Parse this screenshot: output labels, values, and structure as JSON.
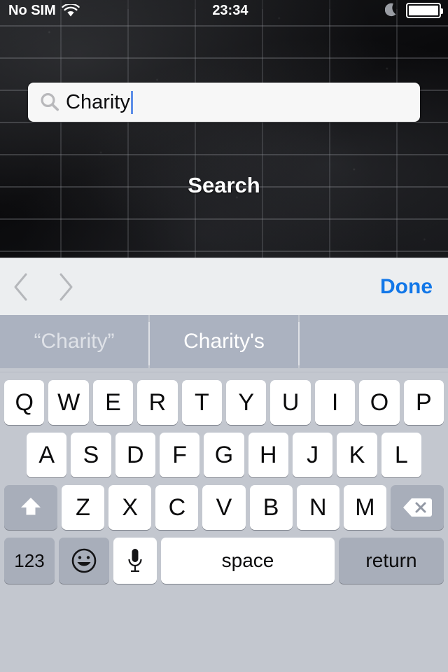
{
  "status_bar": {
    "carrier": "No SIM",
    "wifi_icon": "wifi-icon",
    "time": "23:34",
    "dnd_icon": "moon-icon",
    "battery_icon": "battery-full-icon"
  },
  "app": {
    "background": "brick-wall-photo",
    "search": {
      "icon": "search-icon",
      "value": "Charity",
      "placeholder": "Search",
      "caret_color": "#5e8fe8"
    },
    "search_button_label": "Search"
  },
  "accessory_bar": {
    "prev_icon": "chevron-left-icon",
    "next_icon": "chevron-right-icon",
    "done_label": "Done",
    "done_color": "#1277e8"
  },
  "keyboard": {
    "candidates": [
      {
        "label": "“Charity”",
        "style": "dim"
      },
      {
        "label": "Charity's",
        "style": "normal"
      },
      {
        "label": "",
        "style": "empty"
      }
    ],
    "row1": [
      "Q",
      "W",
      "E",
      "R",
      "T",
      "Y",
      "U",
      "I",
      "O",
      "P"
    ],
    "row2": [
      "A",
      "S",
      "D",
      "F",
      "G",
      "H",
      "J",
      "K",
      "L"
    ],
    "row3": [
      "Z",
      "X",
      "C",
      "V",
      "B",
      "N",
      "M"
    ],
    "shift_icon": "shift-icon",
    "delete_icon": "backspace-icon",
    "numbers_label": "123",
    "emoji_icon": "emoji-smiley-icon",
    "dictation_icon": "microphone-icon",
    "space_label": "space",
    "return_label": "return",
    "key_color": "#ffffff",
    "modifier_color": "#a8aeba",
    "background_color": "#c3c7cf",
    "candidate_color": "#abb2c0"
  }
}
